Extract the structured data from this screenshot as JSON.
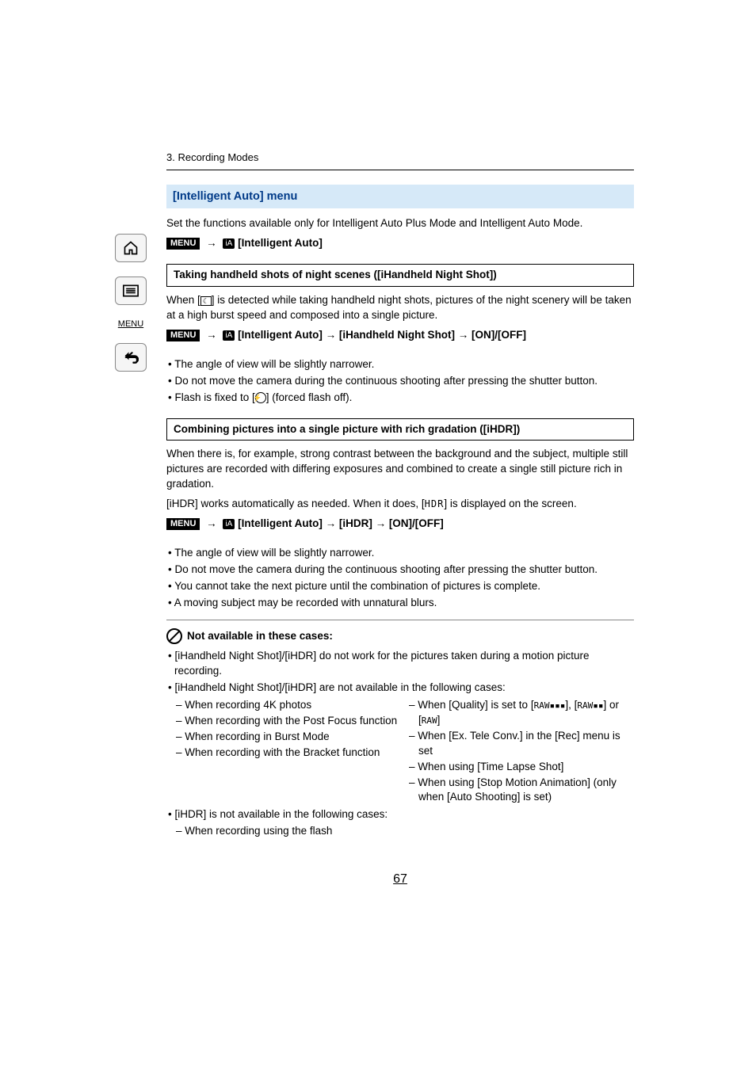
{
  "sidebar": {
    "menu_label": "MENU"
  },
  "chapter": "3. Recording Modes",
  "section_title": "[Intelligent Auto] menu",
  "intro": "Set the functions available only for Intelligent Auto Plus Mode and Intelligent Auto Mode.",
  "path_menu": "MENU",
  "path_ia": "[Intelligent Auto]",
  "sub1": {
    "title": "Taking handheld shots of night scenes ([iHandheld Night Shot])",
    "desc_a": "When [",
    "desc_b": "] is detected while taking handheld night shots, pictures of the night scenery will be taken at a high burst speed and composed into a single picture.",
    "path": "[Intelligent Auto] → [iHandheld Night Shot] → [ON]/[OFF]",
    "bullets": [
      "The angle of view will be slightly narrower.",
      "Do not move the camera during the continuous shooting after pressing the shutter button."
    ],
    "flash_a": "Flash is fixed to [",
    "flash_b": "] (forced flash off)."
  },
  "sub2": {
    "title": "Combining pictures into a single picture with rich gradation ([iHDR])",
    "desc1": "When there is, for example, strong contrast between the background and the subject, multiple still pictures are recorded with differing exposures and combined to create a single still picture rich in gradation.",
    "desc2_a": "[iHDR] works automatically as needed. When it does, [",
    "desc2_b": "] is displayed on the screen.",
    "path": "[Intelligent Auto] → [iHDR] → [ON]/[OFF]",
    "bullets": [
      "The angle of view will be slightly narrower.",
      "Do not move the camera during the continuous shooting after pressing the shutter button.",
      "You cannot take the next picture until the combination of pictures is complete.",
      "A moving subject may be recorded with unnatural blurs."
    ]
  },
  "na": {
    "title": "Not available in these cases:",
    "b1": "[iHandheld Night Shot]/[iHDR] do not work for the pictures taken during a motion picture recording.",
    "b2": "[iHandheld Night Shot]/[iHDR] are not available in the following cases:",
    "left": [
      "When recording 4K photos",
      "When recording with the Post Focus function",
      "When recording in Burst Mode",
      "When recording with the Bracket function"
    ],
    "right_0a": "When [Quality] is set to [",
    "right_0b": "], [",
    "right_0c": "] or [",
    "right_0d": "]",
    "right_rest": [
      "When [Ex. Tele Conv.] in the [Rec] menu is set",
      "When using [Time Lapse Shot]",
      "When using [Stop Motion Animation] (only when [Auto Shooting] is set)"
    ],
    "b3": "[iHDR] is not available in the following cases:",
    "b3_sub": "When recording using the flash"
  },
  "page": "67"
}
